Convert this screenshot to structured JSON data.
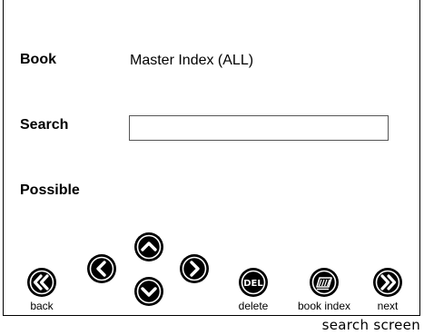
{
  "form": {
    "book_label": "Book",
    "book_value": "Master Index (ALL)",
    "search_label": "Search",
    "search_value": "",
    "possible_label": "Possible"
  },
  "toolbar": {
    "back_label": "back",
    "delete_label": "delete",
    "delete_icon_text": "DEL",
    "book_index_label": "book index",
    "next_label": "next"
  },
  "caption": "search screen",
  "colors": {
    "button_fill": "#000000",
    "button_ring": "#000000",
    "button_glyph": "#ffffff",
    "border": "#000000"
  },
  "icons": {
    "back": "double-chevron-left-icon",
    "left": "chevron-left-icon",
    "up": "chevron-up-icon",
    "down": "chevron-down-icon",
    "right": "chevron-right-icon",
    "delete": "del-icon",
    "book_index": "book-index-icon",
    "next": "double-chevron-right-icon"
  }
}
